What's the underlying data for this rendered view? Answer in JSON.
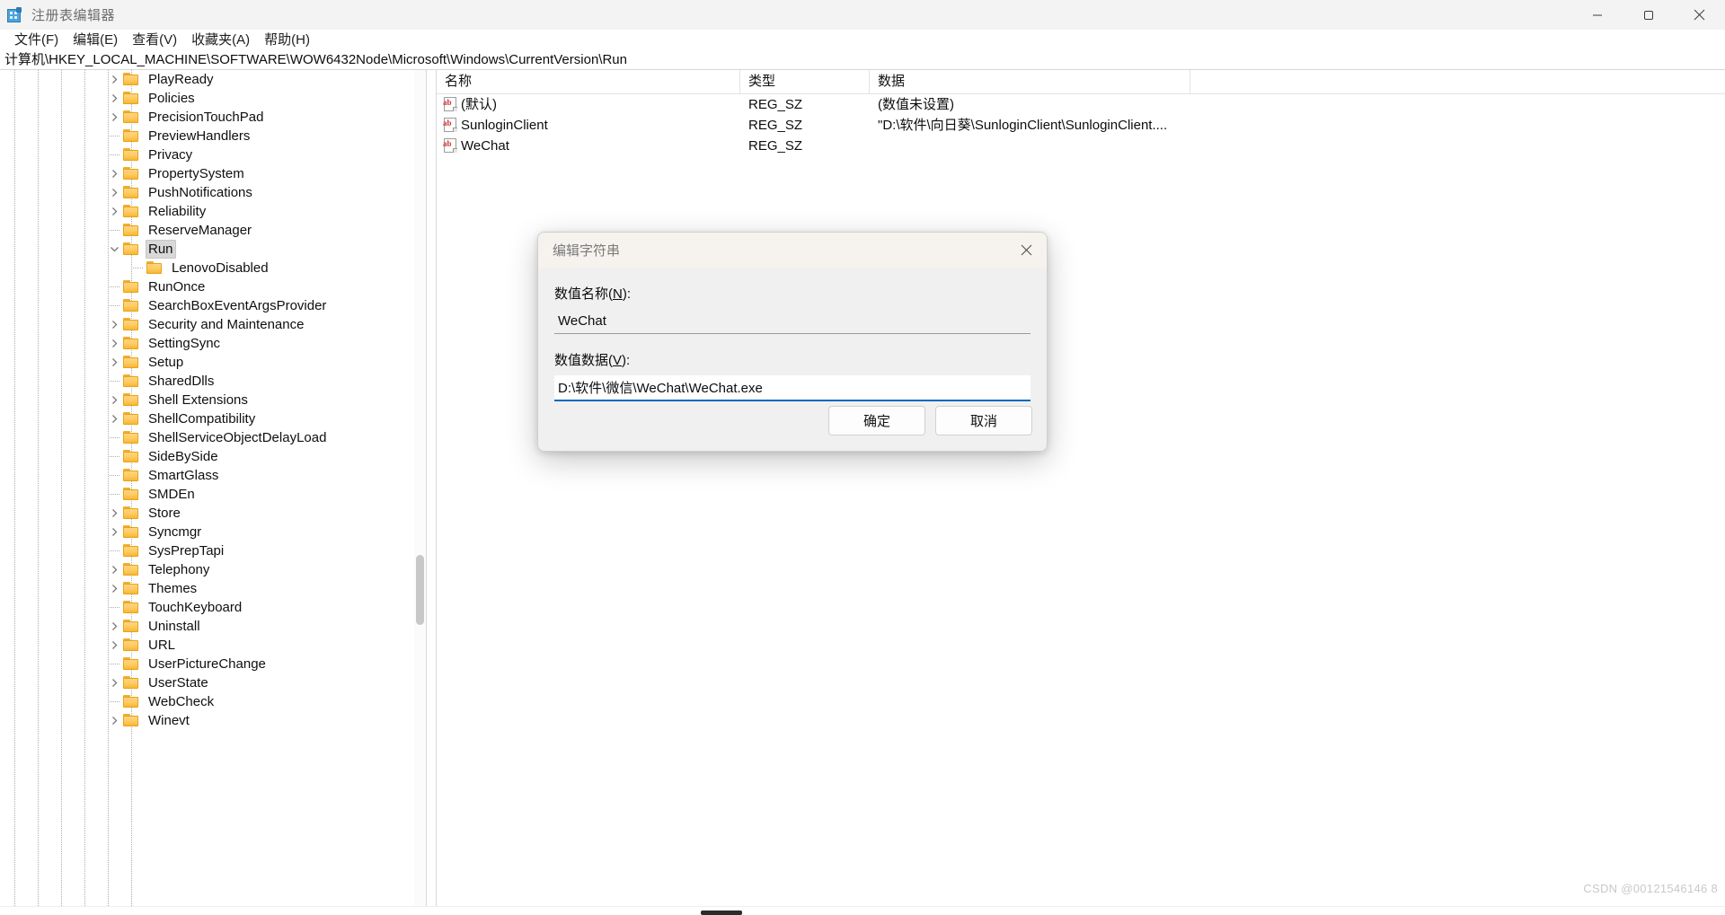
{
  "window": {
    "title": "注册表编辑器",
    "app_icon": "registry-editor-icon",
    "minimize_label": "—",
    "maximize_label": "▢",
    "close_label": "✕"
  },
  "menubar": {
    "items": [
      {
        "label": "文件(F)",
        "name": "menu-file"
      },
      {
        "label": "编辑(E)",
        "name": "menu-edit"
      },
      {
        "label": "查看(V)",
        "name": "menu-view"
      },
      {
        "label": "收藏夹(A)",
        "name": "menu-favorites"
      },
      {
        "label": "帮助(H)",
        "name": "menu-help"
      }
    ]
  },
  "address": {
    "path": "计算机\\HKEY_LOCAL_MACHINE\\SOFTWARE\\WOW6432Node\\Microsoft\\Windows\\CurrentVersion\\Run"
  },
  "tree": {
    "items": [
      {
        "label": "PlayReady",
        "indent": 1,
        "expander": "collapsed",
        "selected": false
      },
      {
        "label": "Policies",
        "indent": 1,
        "expander": "collapsed",
        "selected": false
      },
      {
        "label": "PrecisionTouchPad",
        "indent": 1,
        "expander": "collapsed",
        "selected": false
      },
      {
        "label": "PreviewHandlers",
        "indent": 1,
        "expander": "none",
        "selected": false
      },
      {
        "label": "Privacy",
        "indent": 1,
        "expander": "none",
        "selected": false
      },
      {
        "label": "PropertySystem",
        "indent": 1,
        "expander": "collapsed",
        "selected": false
      },
      {
        "label": "PushNotifications",
        "indent": 1,
        "expander": "collapsed",
        "selected": false
      },
      {
        "label": "Reliability",
        "indent": 1,
        "expander": "collapsed",
        "selected": false
      },
      {
        "label": "ReserveManager",
        "indent": 1,
        "expander": "none",
        "selected": false
      },
      {
        "label": "Run",
        "indent": 1,
        "expander": "expanded",
        "selected": true
      },
      {
        "label": "LenovoDisabled",
        "indent": 2,
        "expander": "none",
        "selected": false
      },
      {
        "label": "RunOnce",
        "indent": 1,
        "expander": "none",
        "selected": false
      },
      {
        "label": "SearchBoxEventArgsProvider",
        "indent": 1,
        "expander": "none",
        "selected": false
      },
      {
        "label": "Security and Maintenance",
        "indent": 1,
        "expander": "collapsed",
        "selected": false
      },
      {
        "label": "SettingSync",
        "indent": 1,
        "expander": "collapsed",
        "selected": false
      },
      {
        "label": "Setup",
        "indent": 1,
        "expander": "collapsed",
        "selected": false
      },
      {
        "label": "SharedDlls",
        "indent": 1,
        "expander": "none",
        "selected": false
      },
      {
        "label": "Shell Extensions",
        "indent": 1,
        "expander": "collapsed",
        "selected": false
      },
      {
        "label": "ShellCompatibility",
        "indent": 1,
        "expander": "collapsed",
        "selected": false
      },
      {
        "label": "ShellServiceObjectDelayLoad",
        "indent": 1,
        "expander": "none",
        "selected": false
      },
      {
        "label": "SideBySide",
        "indent": 1,
        "expander": "none",
        "selected": false
      },
      {
        "label": "SmartGlass",
        "indent": 1,
        "expander": "none",
        "selected": false
      },
      {
        "label": "SMDEn",
        "indent": 1,
        "expander": "none",
        "selected": false
      },
      {
        "label": "Store",
        "indent": 1,
        "expander": "collapsed",
        "selected": false
      },
      {
        "label": "Syncmgr",
        "indent": 1,
        "expander": "collapsed",
        "selected": false
      },
      {
        "label": "SysPrepTapi",
        "indent": 1,
        "expander": "none",
        "selected": false
      },
      {
        "label": "Telephony",
        "indent": 1,
        "expander": "collapsed",
        "selected": false
      },
      {
        "label": "Themes",
        "indent": 1,
        "expander": "collapsed",
        "selected": false
      },
      {
        "label": "TouchKeyboard",
        "indent": 1,
        "expander": "none",
        "selected": false
      },
      {
        "label": "Uninstall",
        "indent": 1,
        "expander": "collapsed",
        "selected": false
      },
      {
        "label": "URL",
        "indent": 1,
        "expander": "collapsed",
        "selected": false
      },
      {
        "label": "UserPictureChange",
        "indent": 1,
        "expander": "none",
        "selected": false
      },
      {
        "label": "UserState",
        "indent": 1,
        "expander": "collapsed",
        "selected": false
      },
      {
        "label": "WebCheck",
        "indent": 1,
        "expander": "none",
        "selected": false
      },
      {
        "label": "Winevt",
        "indent": 1,
        "expander": "collapsed",
        "selected": false
      }
    ]
  },
  "list": {
    "columns": [
      {
        "label": "名称",
        "name": "column-name"
      },
      {
        "label": "类型",
        "name": "column-type"
      },
      {
        "label": "数据",
        "name": "column-data"
      }
    ],
    "rows": [
      {
        "name": "(默认)",
        "type": "REG_SZ",
        "data": "(数值未设置)",
        "icon": "string-value-icon"
      },
      {
        "name": "SunloginClient",
        "type": "REG_SZ",
        "data": "\"D:\\软件\\向日葵\\SunloginClient\\SunloginClient....",
        "icon": "string-value-icon"
      },
      {
        "name": "WeChat",
        "type": "REG_SZ",
        "data": "",
        "icon": "string-value-icon"
      }
    ]
  },
  "dialog": {
    "title": "编辑字符串",
    "close_label": "✕",
    "name_label_pre": "数值名称(",
    "name_label_key": "N",
    "name_label_post": "):",
    "name_value": "WeChat",
    "data_label_pre": "数值数据(",
    "data_label_key": "V",
    "data_label_post": "):",
    "data_value": "D:\\软件\\微信\\WeChat\\WeChat.exe",
    "ok_label": "确定",
    "cancel_label": "取消"
  },
  "watermark": {
    "text": "CSDN @00121546146 8"
  }
}
